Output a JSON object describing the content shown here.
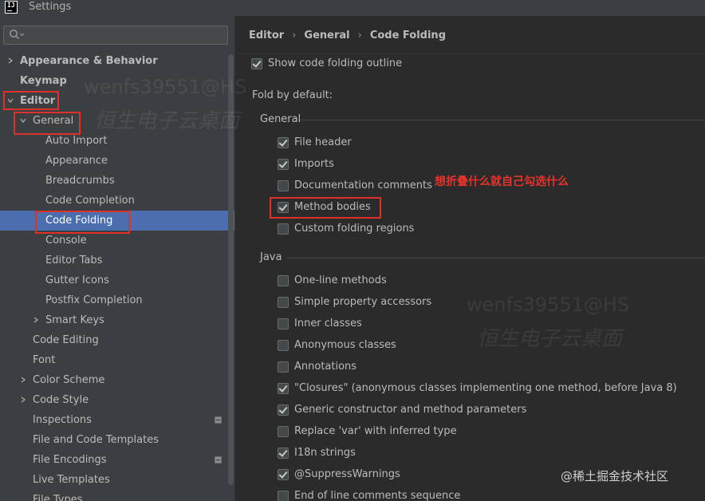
{
  "window": {
    "title": "Settings",
    "logo_text": "IJ"
  },
  "search": {
    "placeholder": "",
    "value": "",
    "icon": "search-icon"
  },
  "sidebar": {
    "items": [
      {
        "label": "Appearance & Behavior",
        "indent": 0,
        "bold": true,
        "chevron": "right"
      },
      {
        "label": "Keymap",
        "indent": 0,
        "bold": true,
        "chevron": "none"
      },
      {
        "label": "Editor",
        "indent": 0,
        "bold": true,
        "chevron": "down"
      },
      {
        "label": "General",
        "indent": 1,
        "bold": false,
        "chevron": "down"
      },
      {
        "label": "Auto Import",
        "indent": 2,
        "bold": false,
        "chevron": "none"
      },
      {
        "label": "Appearance",
        "indent": 2,
        "bold": false,
        "chevron": "none"
      },
      {
        "label": "Breadcrumbs",
        "indent": 2,
        "bold": false,
        "chevron": "none"
      },
      {
        "label": "Code Completion",
        "indent": 2,
        "bold": false,
        "chevron": "none"
      },
      {
        "label": "Code Folding",
        "indent": 2,
        "bold": false,
        "chevron": "none",
        "selected": true
      },
      {
        "label": "Console",
        "indent": 2,
        "bold": false,
        "chevron": "none"
      },
      {
        "label": "Editor Tabs",
        "indent": 2,
        "bold": false,
        "chevron": "none"
      },
      {
        "label": "Gutter Icons",
        "indent": 2,
        "bold": false,
        "chevron": "none"
      },
      {
        "label": "Postfix Completion",
        "indent": 2,
        "bold": false,
        "chevron": "none"
      },
      {
        "label": "Smart Keys",
        "indent": 2,
        "bold": false,
        "chevron": "right"
      },
      {
        "label": "Code Editing",
        "indent": 1,
        "bold": false,
        "chevron": "none"
      },
      {
        "label": "Font",
        "indent": 1,
        "bold": false,
        "chevron": "none"
      },
      {
        "label": "Color Scheme",
        "indent": 1,
        "bold": false,
        "chevron": "right"
      },
      {
        "label": "Code Style",
        "indent": 1,
        "bold": false,
        "chevron": "right"
      },
      {
        "label": "Inspections",
        "indent": 1,
        "bold": false,
        "chevron": "none",
        "badge": true
      },
      {
        "label": "File and Code Templates",
        "indent": 1,
        "bold": false,
        "chevron": "none"
      },
      {
        "label": "File Encodings",
        "indent": 1,
        "bold": false,
        "chevron": "none",
        "badge": true
      },
      {
        "label": "Live Templates",
        "indent": 1,
        "bold": false,
        "chevron": "none"
      },
      {
        "label": "File Types",
        "indent": 1,
        "bold": false,
        "chevron": "none"
      }
    ]
  },
  "breadcrumb": {
    "items": [
      "Editor",
      "General",
      "Code Folding"
    ],
    "separator": "›"
  },
  "main": {
    "show_outline": {
      "label": "Show code folding outline",
      "checked": true
    },
    "fold_by_default_label": "Fold by default:",
    "general_group": {
      "title": "General",
      "options": [
        {
          "label": "File header",
          "checked": true
        },
        {
          "label": "Imports",
          "checked": true
        },
        {
          "label": "Documentation comments",
          "checked": false
        },
        {
          "label": "Method bodies",
          "checked": true
        },
        {
          "label": "Custom folding regions",
          "checked": false
        }
      ]
    },
    "java_group": {
      "title": "Java",
      "options": [
        {
          "label": "One-line methods",
          "checked": false
        },
        {
          "label": "Simple property accessors",
          "checked": false
        },
        {
          "label": "Inner classes",
          "checked": false
        },
        {
          "label": "Anonymous classes",
          "checked": false
        },
        {
          "label": "Annotations",
          "checked": false
        },
        {
          "label": "\"Closures\" (anonymous classes implementing one method, before Java 8)",
          "checked": true
        },
        {
          "label": "Generic constructor and method parameters",
          "checked": true
        },
        {
          "label": "Replace 'var' with inferred type",
          "checked": false
        },
        {
          "label": "I18n strings",
          "checked": true
        },
        {
          "label": "@SuppressWarnings",
          "checked": true
        },
        {
          "label": "End of line comments sequence",
          "checked": false
        }
      ]
    }
  },
  "annotation": {
    "text": "想折叠什么就自己勾选什么",
    "color": "#e8332a"
  },
  "watermarks": {
    "line1": "wenfs39551@HS",
    "line2": "恒生电子云桌面"
  },
  "credit": "@稀土掘金技术社区",
  "colors": {
    "sidebar_bg": "#3c3f41",
    "main_bg": "#2b2b2b",
    "selection": "#4b6eaf",
    "annotation_red": "#e0302a"
  }
}
